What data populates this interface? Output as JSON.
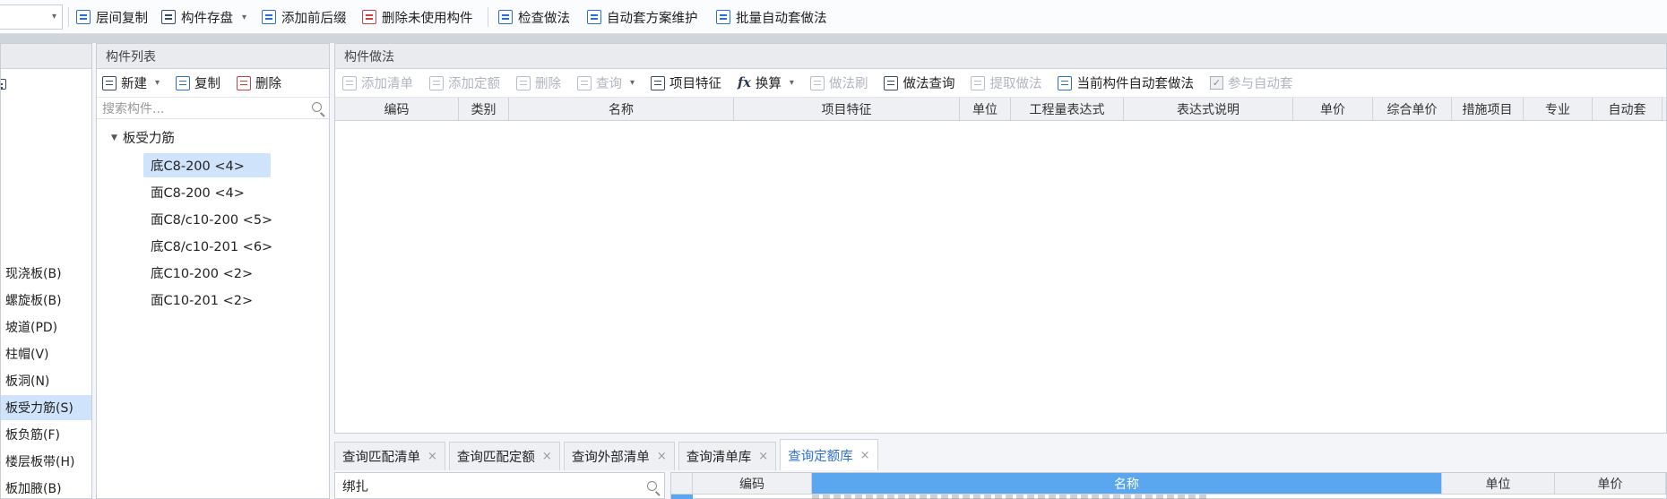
{
  "toolbar": {
    "items": [
      {
        "label": "层间复制",
        "icon": "copy-layers-icon"
      },
      {
        "label": "构件存盘",
        "icon": "save-component-icon"
      },
      {
        "label": "添加前后缀",
        "icon": "add-affix-icon"
      },
      {
        "label": "删除未使用构件",
        "icon": "delete-unused-icon"
      },
      {
        "label": "检查做法",
        "icon": "check-method-icon"
      },
      {
        "label": "自动套方案维护",
        "icon": "auto-scheme-icon"
      },
      {
        "label": "批量自动套做法",
        "icon": "batch-auto-icon"
      }
    ]
  },
  "left_panel": {
    "top_icon": "home-icon",
    "items": [
      "现浇板(B)",
      "螺旋板(B)",
      "坡道(PD)",
      "柱帽(V)",
      "板洞(N)",
      "板受力筋(S)",
      "板负筋(F)",
      "楼层板带(H)",
      "板加腋(B)"
    ],
    "selected": "板受力筋(S)"
  },
  "component_list": {
    "title": "构件列表",
    "new_label": "新建",
    "copy_label": "复制",
    "delete_label": "删除",
    "search_placeholder": "搜索构件...",
    "tree_root": "板受力筋",
    "items": [
      "底C8-200 <4>",
      "面C8-200 <4>",
      "面C8/c10-200 <5>",
      "底C8/c10-201 <6>",
      "底C10-200 <2>",
      "面C10-201 <2>"
    ],
    "selected_index": 0
  },
  "method_panel": {
    "title": "构件做法",
    "tools": {
      "add_list": "添加清单",
      "add_quota": "添加定额",
      "delete": "删除",
      "query": "查询",
      "item_feature": "项目特征",
      "convert": "换算",
      "method_brush": "做法刷",
      "method_query": "做法查询",
      "extract_method": "提取做法",
      "current_auto": "当前构件自动套做法",
      "join_auto": "参与自动套"
    },
    "columns": [
      "编码",
      "类别",
      "名称",
      "项目特征",
      "单位",
      "工程量表达式",
      "表达式说明",
      "单价",
      "综合单价",
      "措施项目",
      "专业",
      "自动套"
    ]
  },
  "bottom_tabs": [
    {
      "label": "查询匹配清单",
      "active": false
    },
    {
      "label": "查询匹配定额",
      "active": false
    },
    {
      "label": "查询外部清单",
      "active": false
    },
    {
      "label": "查询清单库",
      "active": false
    },
    {
      "label": "查询定额库",
      "active": true
    }
  ],
  "query_search_value": "绑扎",
  "query_grid": {
    "columns": [
      "编码",
      "名称",
      "单位",
      "单价"
    ]
  }
}
